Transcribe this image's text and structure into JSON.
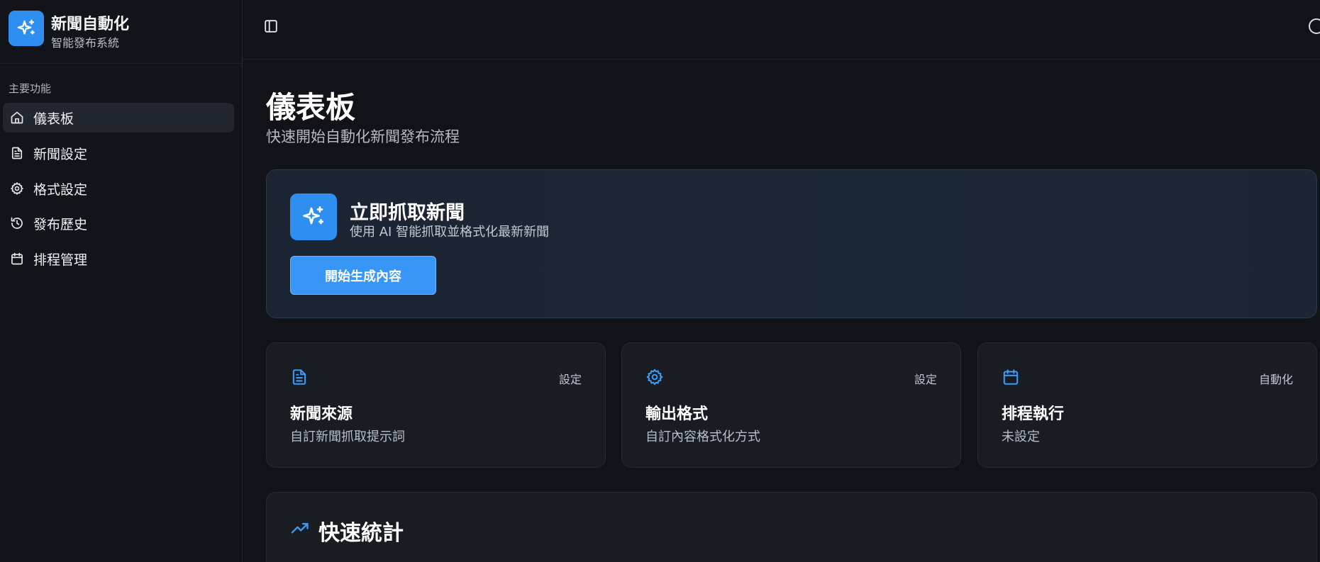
{
  "brand": {
    "title": "新聞自動化",
    "subtitle": "智能發布系統",
    "logo_icon": "sparkles-icon",
    "accent": "#2f8ff0"
  },
  "sidebar": {
    "section_label": "主要功能",
    "items": [
      {
        "label": "儀表板",
        "icon": "home-icon",
        "active": true
      },
      {
        "label": "新聞設定",
        "icon": "document-icon",
        "active": false
      },
      {
        "label": "格式設定",
        "icon": "gear-icon",
        "active": false
      },
      {
        "label": "發布歷史",
        "icon": "history-icon",
        "active": false
      },
      {
        "label": "排程管理",
        "icon": "calendar-icon",
        "active": false
      }
    ]
  },
  "header": {
    "toggle_icon": "sidebar-toggle-icon",
    "profile_icon": "user-circle-icon"
  },
  "main": {
    "title": "儀表板",
    "subtitle": "快速開始自動化新聞發布流程",
    "hero": {
      "icon": "sparkles-icon",
      "title": "立即抓取新聞",
      "subtitle": "使用 AI 智能抓取並格式化最新新聞",
      "button_label": "開始生成內容"
    },
    "cards": [
      {
        "icon": "document-icon",
        "badge": "設定",
        "title": "新聞來源",
        "subtitle": "自訂新聞抓取提示詞"
      },
      {
        "icon": "gear-icon",
        "badge": "設定",
        "title": "輸出格式",
        "subtitle": "自訂內容格式化方式"
      },
      {
        "icon": "calendar-icon",
        "badge": "自動化",
        "title": "排程執行",
        "subtitle": "未設定"
      }
    ],
    "stats": {
      "icon": "trending-up-icon",
      "title": "快速統計"
    }
  },
  "colors": {
    "background": "#111318",
    "sidebar": "#121419",
    "card": "#191c23",
    "accent": "#2f8ff0",
    "icon_blue": "#3b9bf7"
  }
}
